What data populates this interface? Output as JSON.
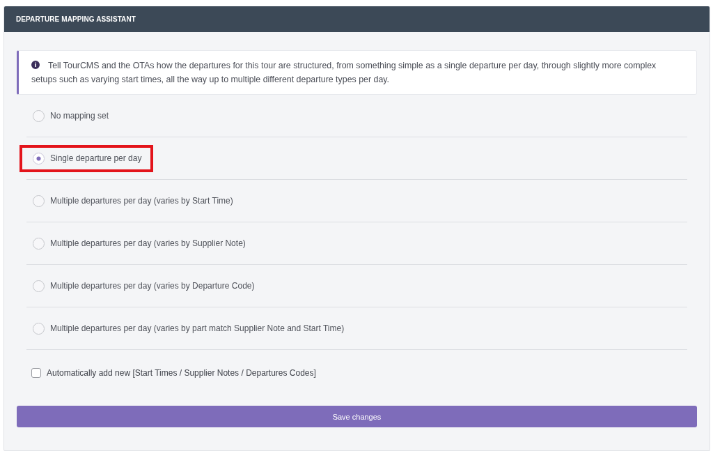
{
  "panel": {
    "title": "DEPARTURE MAPPING ASSISTANT"
  },
  "info": {
    "text": "Tell TourCMS and the OTAs how the departures for this tour are structured, from something simple as a single departure per day, through slightly more complex setups such as varying start times, all the way up to multiple different departure types per day."
  },
  "options": [
    {
      "label": "No mapping set",
      "selected": false,
      "highlighted": false
    },
    {
      "label": "Single departure per day",
      "selected": true,
      "highlighted": true
    },
    {
      "label": "Multiple departures per day (varies by Start Time)",
      "selected": false,
      "highlighted": false
    },
    {
      "label": "Multiple departures per day (varies by Supplier Note)",
      "selected": false,
      "highlighted": false
    },
    {
      "label": "Multiple departures per day (varies by Departure Code)",
      "selected": false,
      "highlighted": false
    },
    {
      "label": "Multiple departures per day (varies by part match Supplier Note and Start Time)",
      "selected": false,
      "highlighted": false
    }
  ],
  "auto_add": {
    "label": "Automatically add new [Start Times / Supplier Notes / Departures Codes]",
    "checked": false
  },
  "buttons": [
    {
      "label": "Save changes"
    }
  ]
}
